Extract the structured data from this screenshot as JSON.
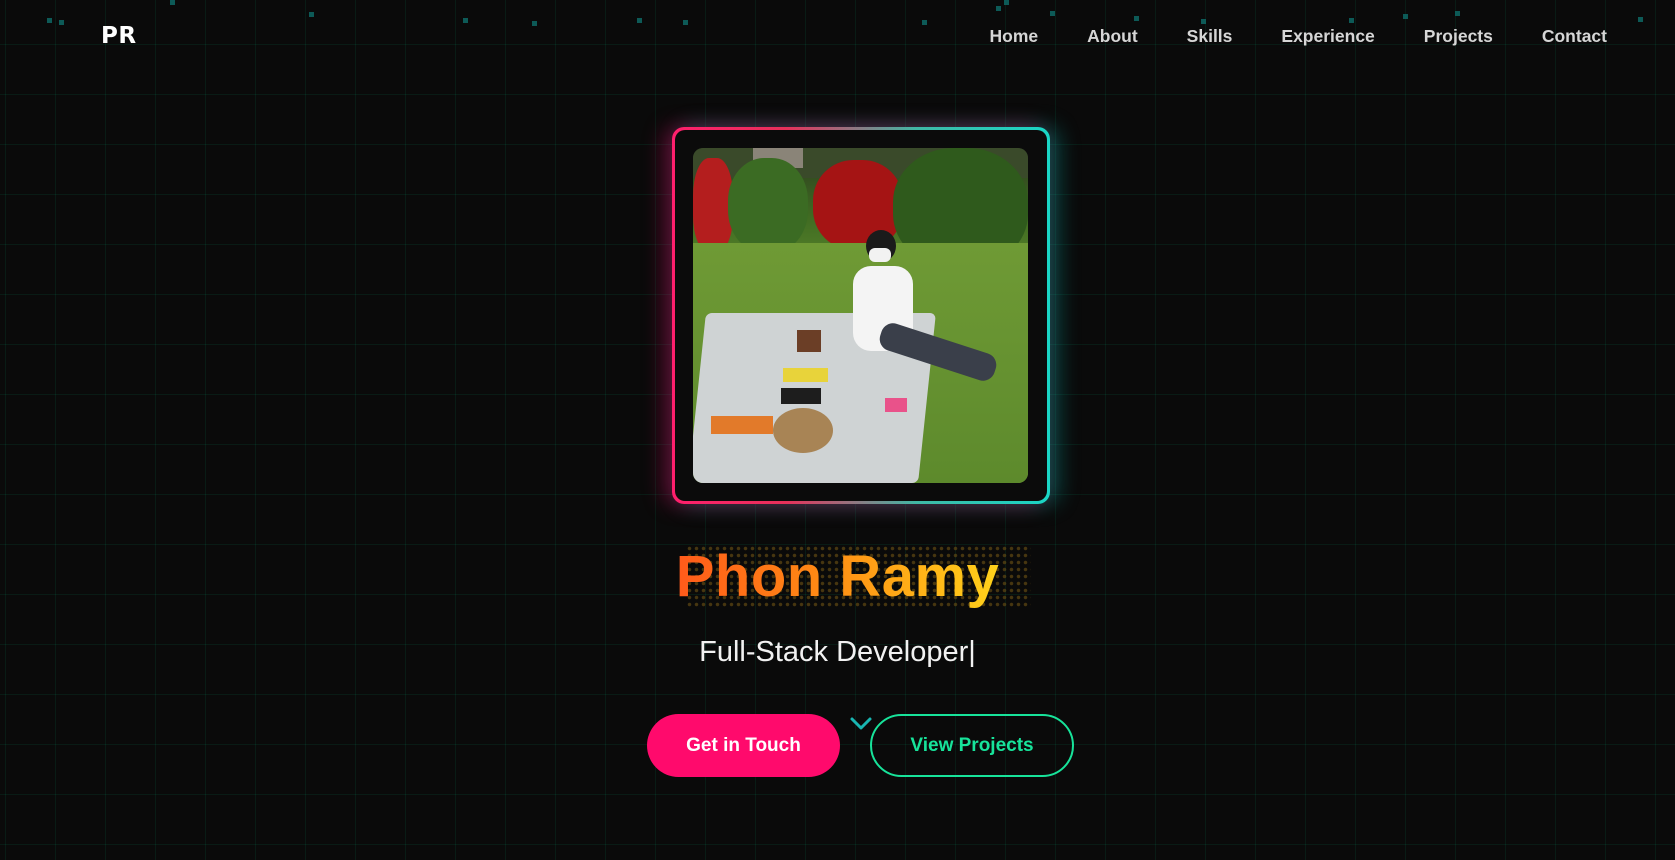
{
  "nav": {
    "logo": "PR",
    "links": [
      "Home",
      "About",
      "Skills",
      "Experience",
      "Projects",
      "Contact"
    ]
  },
  "hero": {
    "name": "Phon Ramy",
    "subtitle": "Full-Stack Developer",
    "cursor": "|",
    "photo_alt": "Profile photo of a person sitting on a picnic blanket in a garden"
  },
  "buttons": {
    "touch_label": "Get in Touch",
    "projects_label": "View Projects"
  },
  "icons": {
    "scroll_indicator": "chevron-down-icon"
  },
  "colors": {
    "background": "#0a0a0a",
    "grid": "#00ffaa",
    "primary_pink": "#ff0a6c",
    "accent_green": "#17e39a",
    "accent_teal": "#19d6c6",
    "name_gradient_start": "#ff5a1a",
    "name_gradient_end": "#ffd21a"
  }
}
